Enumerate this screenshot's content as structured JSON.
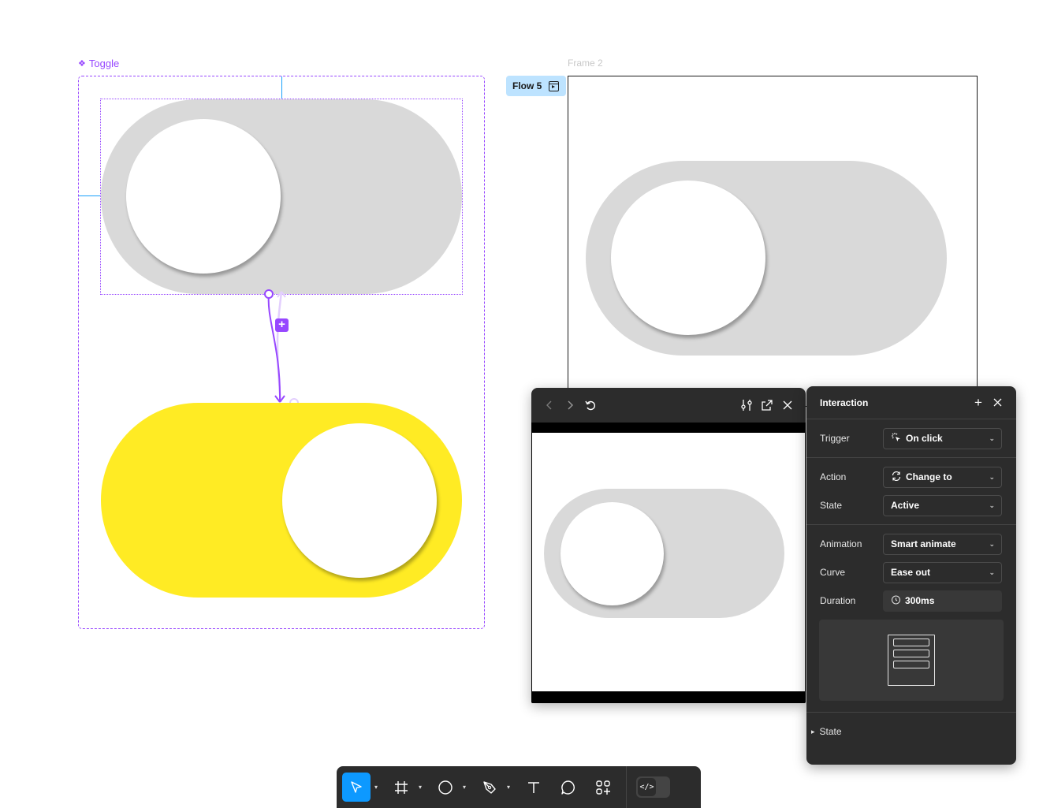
{
  "component_set": {
    "label": "Toggle",
    "accent": "#9747ff"
  },
  "frame": {
    "label": "Frame 2",
    "flow_label": "Flow 5"
  },
  "colors": {
    "track_off": "#d9d9d9",
    "track_on": "#ffeb24",
    "knob": "#ffffff",
    "selection": "#0d99ff"
  },
  "preview": {
    "nav": [
      "chevron-left-icon",
      "chevron-right-icon",
      "restart-icon"
    ],
    "actions": [
      "settings-icon",
      "open-external-icon",
      "close-icon"
    ]
  },
  "interaction": {
    "title": "Interaction",
    "trigger": {
      "label": "Trigger",
      "value": "On click"
    },
    "action": {
      "label": "Action",
      "value": "Change to"
    },
    "state": {
      "label": "State",
      "value": "Active"
    },
    "animation": {
      "label": "Animation",
      "value": "Smart animate"
    },
    "curve": {
      "label": "Curve",
      "value": "Ease out"
    },
    "duration": {
      "label": "Duration",
      "value": "300ms"
    },
    "state_section": "State"
  },
  "toolbar": {
    "tools": [
      "move-tool",
      "frame-tool",
      "shape-tool",
      "pen-tool",
      "text-tool",
      "comment-tool",
      "actions-tool"
    ],
    "dev_mode_icon": "</>"
  }
}
